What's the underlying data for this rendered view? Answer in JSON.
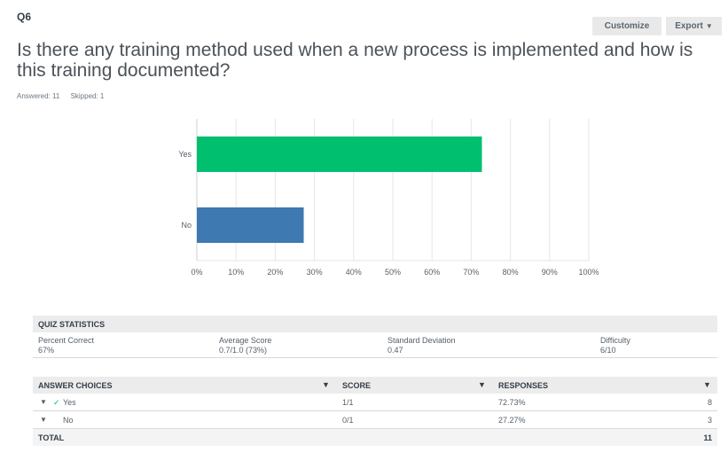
{
  "question": {
    "number": "Q6",
    "title": "Is there any training method used when a new process is implemented and how is this training documented?",
    "answered": "Answered: 11",
    "skipped": "Skipped: 1"
  },
  "toolbar": {
    "customize_label": "Customize",
    "export_label": "Export",
    "export_caret": "▼"
  },
  "chart_data": {
    "type": "bar",
    "orientation": "horizontal",
    "categories": [
      "Yes",
      "No"
    ],
    "values": [
      72.73,
      27.27
    ],
    "colors": [
      "#00bf6f",
      "#3f79b1"
    ],
    "xlim": [
      0,
      100
    ],
    "xticks": [
      "0%",
      "10%",
      "20%",
      "30%",
      "40%",
      "50%",
      "60%",
      "70%",
      "80%",
      "90%",
      "100%"
    ],
    "grid": true
  },
  "quiz_statistics": {
    "header": "QUIZ STATISTICS",
    "items": [
      {
        "label": "Percent Correct",
        "value": "67%"
      },
      {
        "label": "Average Score",
        "value": "0.7/1.0 (73%)"
      },
      {
        "label": "Standard Deviation",
        "value": "0.47"
      },
      {
        "label": "Difficulty",
        "value": "6/10"
      }
    ]
  },
  "answer_table": {
    "headers": {
      "choices": "ANSWER CHOICES",
      "score": "SCORE",
      "responses": "RESPONSES",
      "sort_icon": "▼"
    },
    "rows": [
      {
        "toggle": "▼",
        "check": "✓",
        "choice": "Yes",
        "score": "1/1",
        "percent": "72.73%",
        "count": "8"
      },
      {
        "toggle": "▼",
        "check": "",
        "choice": "No",
        "score": "0/1",
        "percent": "27.27%",
        "count": "3"
      }
    ],
    "total_label": "TOTAL",
    "total_count": "11"
  }
}
